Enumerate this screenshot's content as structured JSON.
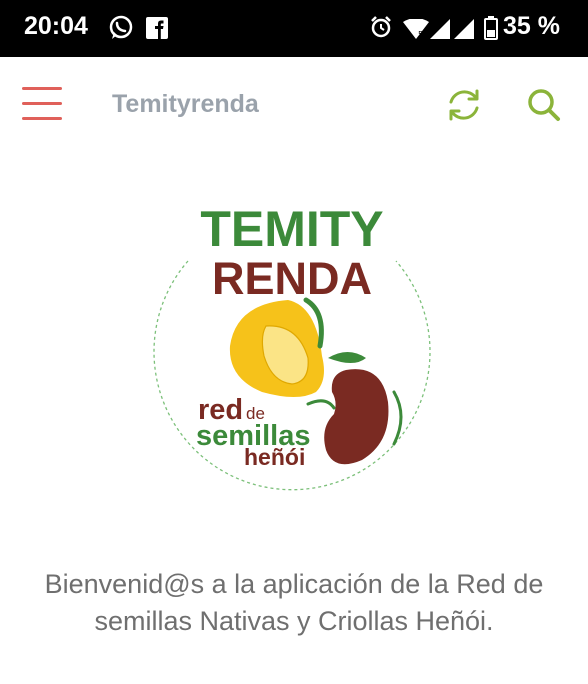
{
  "status_bar": {
    "time": "20:04",
    "battery": "35 %",
    "icons": [
      "whatsapp-icon",
      "facebook-icon",
      "alarm-icon",
      "wifi-icon",
      "signal-icon",
      "battery-icon"
    ]
  },
  "app_bar": {
    "title": "Temityrenda",
    "icons": [
      "hamburger-menu-icon",
      "refresh-icon",
      "search-icon"
    ],
    "colors": {
      "menu": "#e0605a",
      "title": "#9aa2ab",
      "actions": "#8bb43a"
    }
  },
  "logo": {
    "line1": "TEMITY",
    "line2": "RENDA",
    "sub1": "red",
    "sub1_small": "de",
    "sub2": "semillas",
    "sub3": "heñói",
    "colors": {
      "green": "#3c8a3a",
      "brown": "#7a2a22",
      "yellow": "#f6c21a",
      "ring": "#7cc07a"
    }
  },
  "welcome_text": "Bienvenid@s a la aplicación de la Red de semillas Nativas y Criollas Heñói."
}
